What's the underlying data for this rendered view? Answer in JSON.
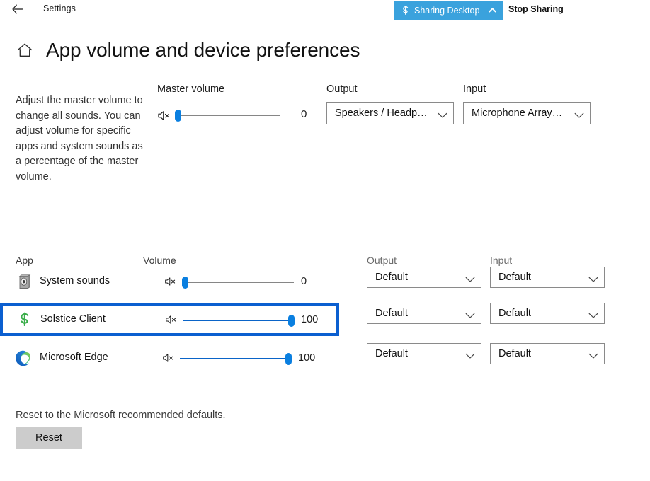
{
  "titlebar": {
    "back_icon": "back-arrow-icon",
    "app_title": "Settings",
    "sharing_badge": {
      "logo_icon": "solstice-s-logo-icon",
      "label": "Sharing Desktop",
      "caret_icon": "chevron-up-icon",
      "background_color": "#3aa2dd",
      "text_color": "#ffffff"
    },
    "stop_sharing_label": "Stop Sharing"
  },
  "header": {
    "home_icon": "home-icon",
    "page_title": "App volume and device preferences"
  },
  "description": "Adjust the master volume to change all sounds. You can adjust volume for specific apps and system sounds as a percentage of the master volume.",
  "master": {
    "label": "Master volume",
    "mute_icon": "speaker-mute-icon",
    "value": "0",
    "value_pct": 0,
    "output": {
      "label": "Output",
      "value": "Speakers / Headp…",
      "chevron_icon": "chevron-down-icon"
    },
    "input": {
      "label": "Input",
      "value": "Microphone Array…",
      "chevron_icon": "chevron-down-icon"
    }
  },
  "app_list": {
    "headers": {
      "app": "App",
      "volume": "Volume",
      "output": "Output",
      "input": "Input"
    },
    "rows": [
      {
        "icon": "system-sounds-icon",
        "name": "System sounds",
        "mute_icon": "speaker-mute-icon",
        "value": "0",
        "value_pct": 0,
        "output": "Default",
        "input": "Default",
        "focused": false
      },
      {
        "icon": "solstice-s-logo-icon",
        "name": "Solstice Client",
        "mute_icon": "speaker-mute-icon",
        "value": "100",
        "value_pct": 100,
        "output": "Default",
        "input": "Default",
        "focused": true
      },
      {
        "icon": "microsoft-edge-icon",
        "name": "Microsoft Edge",
        "mute_icon": "speaker-mute-icon",
        "value": "100",
        "value_pct": 100,
        "output": "Default",
        "input": "Default",
        "focused": false
      }
    ],
    "chevron_icon": "chevron-down-icon"
  },
  "reset": {
    "text": "Reset to the Microsoft recommended defaults.",
    "button_label": "Reset"
  },
  "colors": {
    "accent_blue": "#0a7fe0",
    "focus_blue": "#0b5fd0",
    "sharing_blue": "#3aa2dd",
    "solstice_green": "#3aad4a",
    "track_gray": "#868686"
  }
}
